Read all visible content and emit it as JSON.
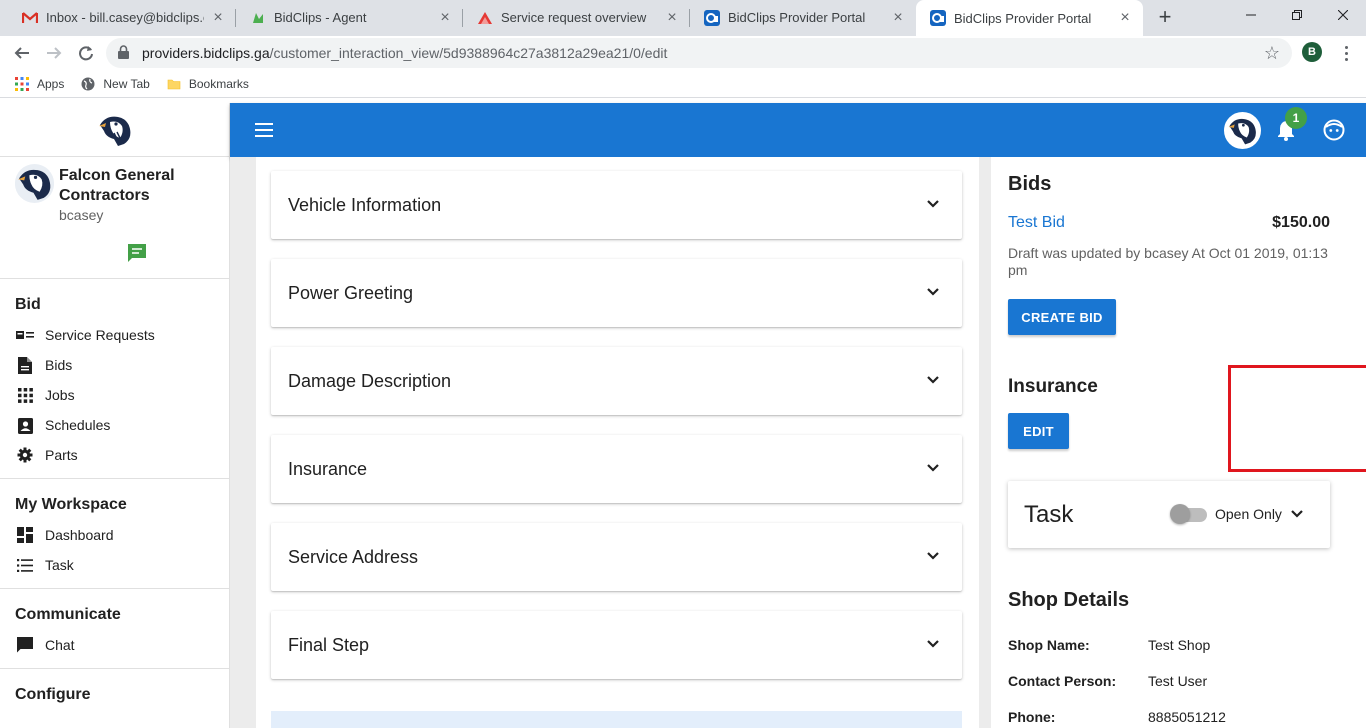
{
  "browser": {
    "tabs": [
      {
        "title": "Inbox - bill.casey@bidclips.com",
        "icon": "gmail-icon"
      },
      {
        "title": "BidClips - Agent",
        "icon": "bidclips-agent-icon"
      },
      {
        "title": "Service request overview",
        "icon": "service-request-icon"
      },
      {
        "title": "BidClips Provider Portal",
        "icon": "portal-icon"
      },
      {
        "title": "BidClips Provider Portal",
        "icon": "portal-icon"
      }
    ],
    "url_host": "providers.bidclips.ga",
    "url_path": "/customer_interaction_view/5d9388964c27a3812a29ea21/0/edit",
    "profile_initial": "B",
    "bookmarks": [
      "Apps",
      "New Tab",
      "Bookmarks"
    ]
  },
  "sidebar": {
    "company": "Falcon General Contractors",
    "username": "bcasey",
    "sections": [
      {
        "title": "Bid",
        "items": [
          {
            "label": "Service Requests",
            "icon": "service-requests-icon"
          },
          {
            "label": "Bids",
            "icon": "document-icon"
          },
          {
            "label": "Jobs",
            "icon": "grid-icon"
          },
          {
            "label": "Schedules",
            "icon": "contact-calendar-icon"
          },
          {
            "label": "Parts",
            "icon": "gear-icon"
          }
        ]
      },
      {
        "title": "My Workspace",
        "items": [
          {
            "label": "Dashboard",
            "icon": "dashboard-icon"
          },
          {
            "label": "Task",
            "icon": "list-icon"
          }
        ]
      },
      {
        "title": "Communicate",
        "items": [
          {
            "label": "Chat",
            "icon": "chat-icon"
          }
        ]
      },
      {
        "title": "Configure",
        "items": []
      }
    ]
  },
  "topbar": {
    "notification_count": "1"
  },
  "accordions": [
    "Vehicle Information",
    "Power Greeting",
    "Damage Description",
    "Insurance",
    "Service Address",
    "Final Step"
  ],
  "right": {
    "bids_title": "Bids",
    "bid_name": "Test Bid",
    "bid_amount": "$150.00",
    "draft_note": "Draft was updated by bcasey At Oct 01 2019, 01:13 pm",
    "create_bid_label": "CREATE BID",
    "insurance_title": "Insurance",
    "edit_label": "EDIT",
    "task_title": "Task",
    "open_only_label": "Open Only",
    "open_only_on": false,
    "shop_title": "Shop Details",
    "shop_fields": [
      {
        "label": "Shop Name:",
        "value": "Test Shop",
        "link": true
      },
      {
        "label": "Contact Person:",
        "value": "Test User",
        "link": false
      },
      {
        "label": "Phone:",
        "value": "8885051212",
        "link": false
      }
    ]
  },
  "colors": {
    "primary": "#1976d2",
    "highlight": "#e0161e",
    "badge": "#43a047",
    "chat_icon": "#43a047"
  }
}
